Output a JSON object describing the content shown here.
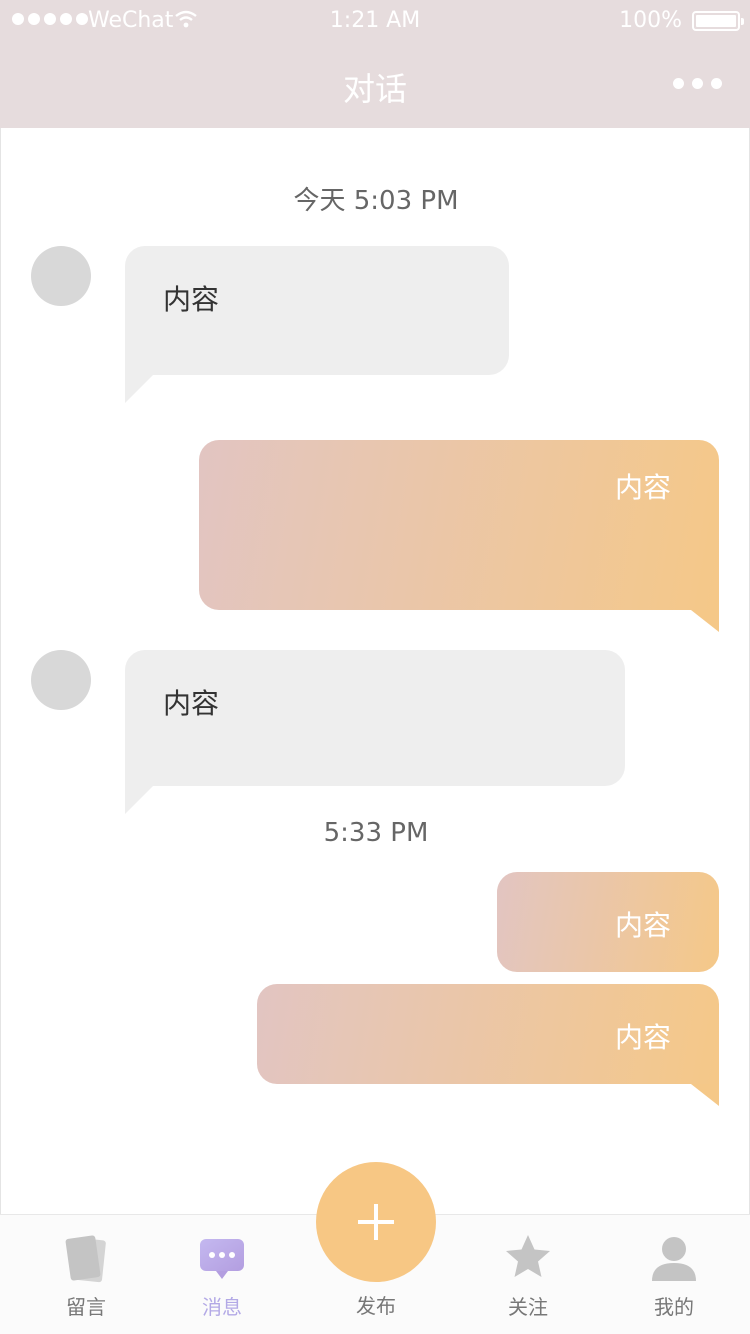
{
  "status_bar": {
    "carrier": "WeChat",
    "time": "1:21 AM",
    "battery": "100%"
  },
  "nav": {
    "title": "对话"
  },
  "messages": [
    {
      "type": "timestamp",
      "text": "今天 5:03 PM"
    },
    {
      "side": "incoming",
      "text": "内容"
    },
    {
      "side": "outgoing",
      "text": "内容"
    },
    {
      "side": "incoming",
      "text": "内容"
    },
    {
      "type": "timestamp",
      "text": "5:33 PM"
    },
    {
      "side": "outgoing",
      "text": "内容"
    },
    {
      "side": "outgoing",
      "text": "内容"
    }
  ],
  "tabbar": {
    "items": [
      {
        "label": "留言",
        "icon": "cards-icon",
        "active": false
      },
      {
        "label": "消息",
        "icon": "message-icon",
        "active": true
      },
      {
        "label": "发布",
        "icon": "plus-icon",
        "active": false
      },
      {
        "label": "关注",
        "icon": "star-icon",
        "active": false
      },
      {
        "label": "我的",
        "icon": "person-icon",
        "active": false
      }
    ]
  },
  "colors": {
    "header_bg": "#e6dcdd",
    "incoming_bubble": "#eeeeee",
    "outgoing_gradient_start": "#e2c5c2",
    "outgoing_gradient_end": "#f5c888",
    "active_tab": "#b3a9e6",
    "fab": "#f7c784"
  }
}
